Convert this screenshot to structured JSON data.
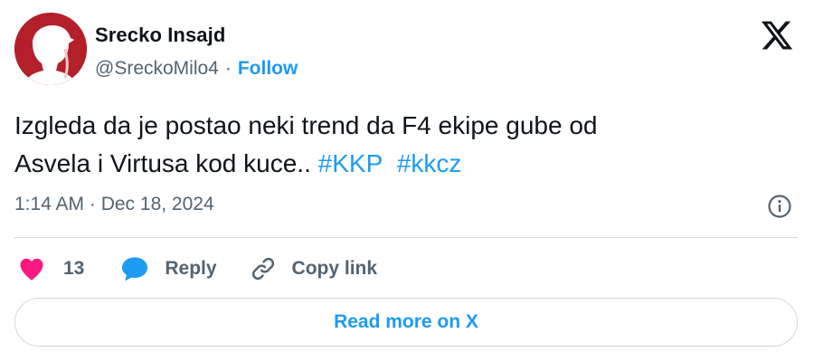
{
  "user": {
    "name": "Srecko Insajd",
    "handle": "@SreckoMilo4",
    "separator": "·",
    "follow_label": "Follow",
    "avatar_color": "#b3202a"
  },
  "tweet": {
    "text_line1": "Izgleda da je postao neki trend da F4 ekipe gube od",
    "text_line2_plain": "Asvela i Virtusa kod kuce.. ",
    "hashtags": [
      "#KKP",
      "#kkcz"
    ],
    "timestamp": "1:14 AM · Dec 18, 2024"
  },
  "actions": {
    "like_count": "13",
    "reply_label": "Reply",
    "copy_link_label": "Copy link"
  },
  "read_more_label": "Read more on X",
  "icons": {
    "brand": "x-logo-icon",
    "info": "info-icon",
    "like": "heart-icon",
    "reply": "speech-bubble-icon",
    "copy": "link-icon"
  },
  "colors": {
    "accent": "#1d9bf0",
    "like": "#f91880",
    "text": "#0f1419",
    "secondary": "#536471",
    "border": "#cfd9de"
  }
}
